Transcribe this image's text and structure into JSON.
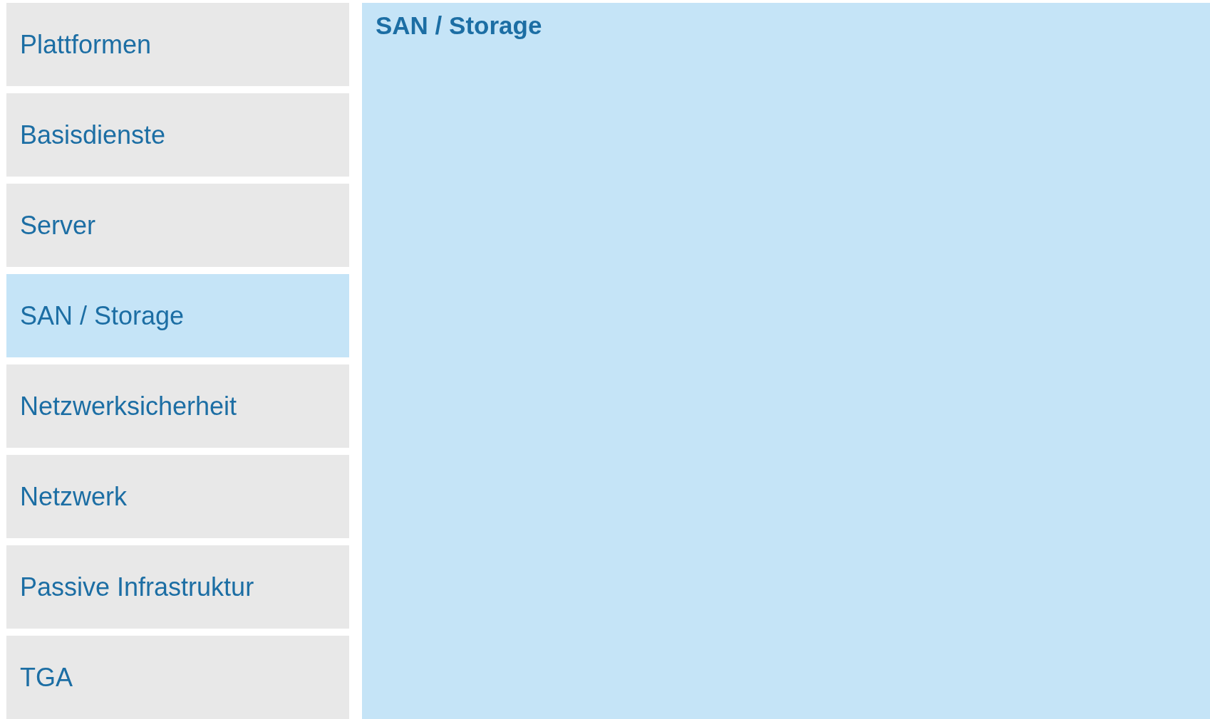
{
  "sidebar": {
    "items": [
      {
        "label": "Plattformen",
        "selected": false
      },
      {
        "label": "Basisdienste",
        "selected": false
      },
      {
        "label": "Server",
        "selected": false
      },
      {
        "label": "SAN / Storage",
        "selected": true
      },
      {
        "label": "Netzwerksicherheit",
        "selected": false
      },
      {
        "label": "Netzwerk",
        "selected": false
      },
      {
        "label": "Passive Infrastruktur",
        "selected": false
      },
      {
        "label": "TGA",
        "selected": false
      }
    ]
  },
  "panel": {
    "title": "SAN / Storage"
  }
}
